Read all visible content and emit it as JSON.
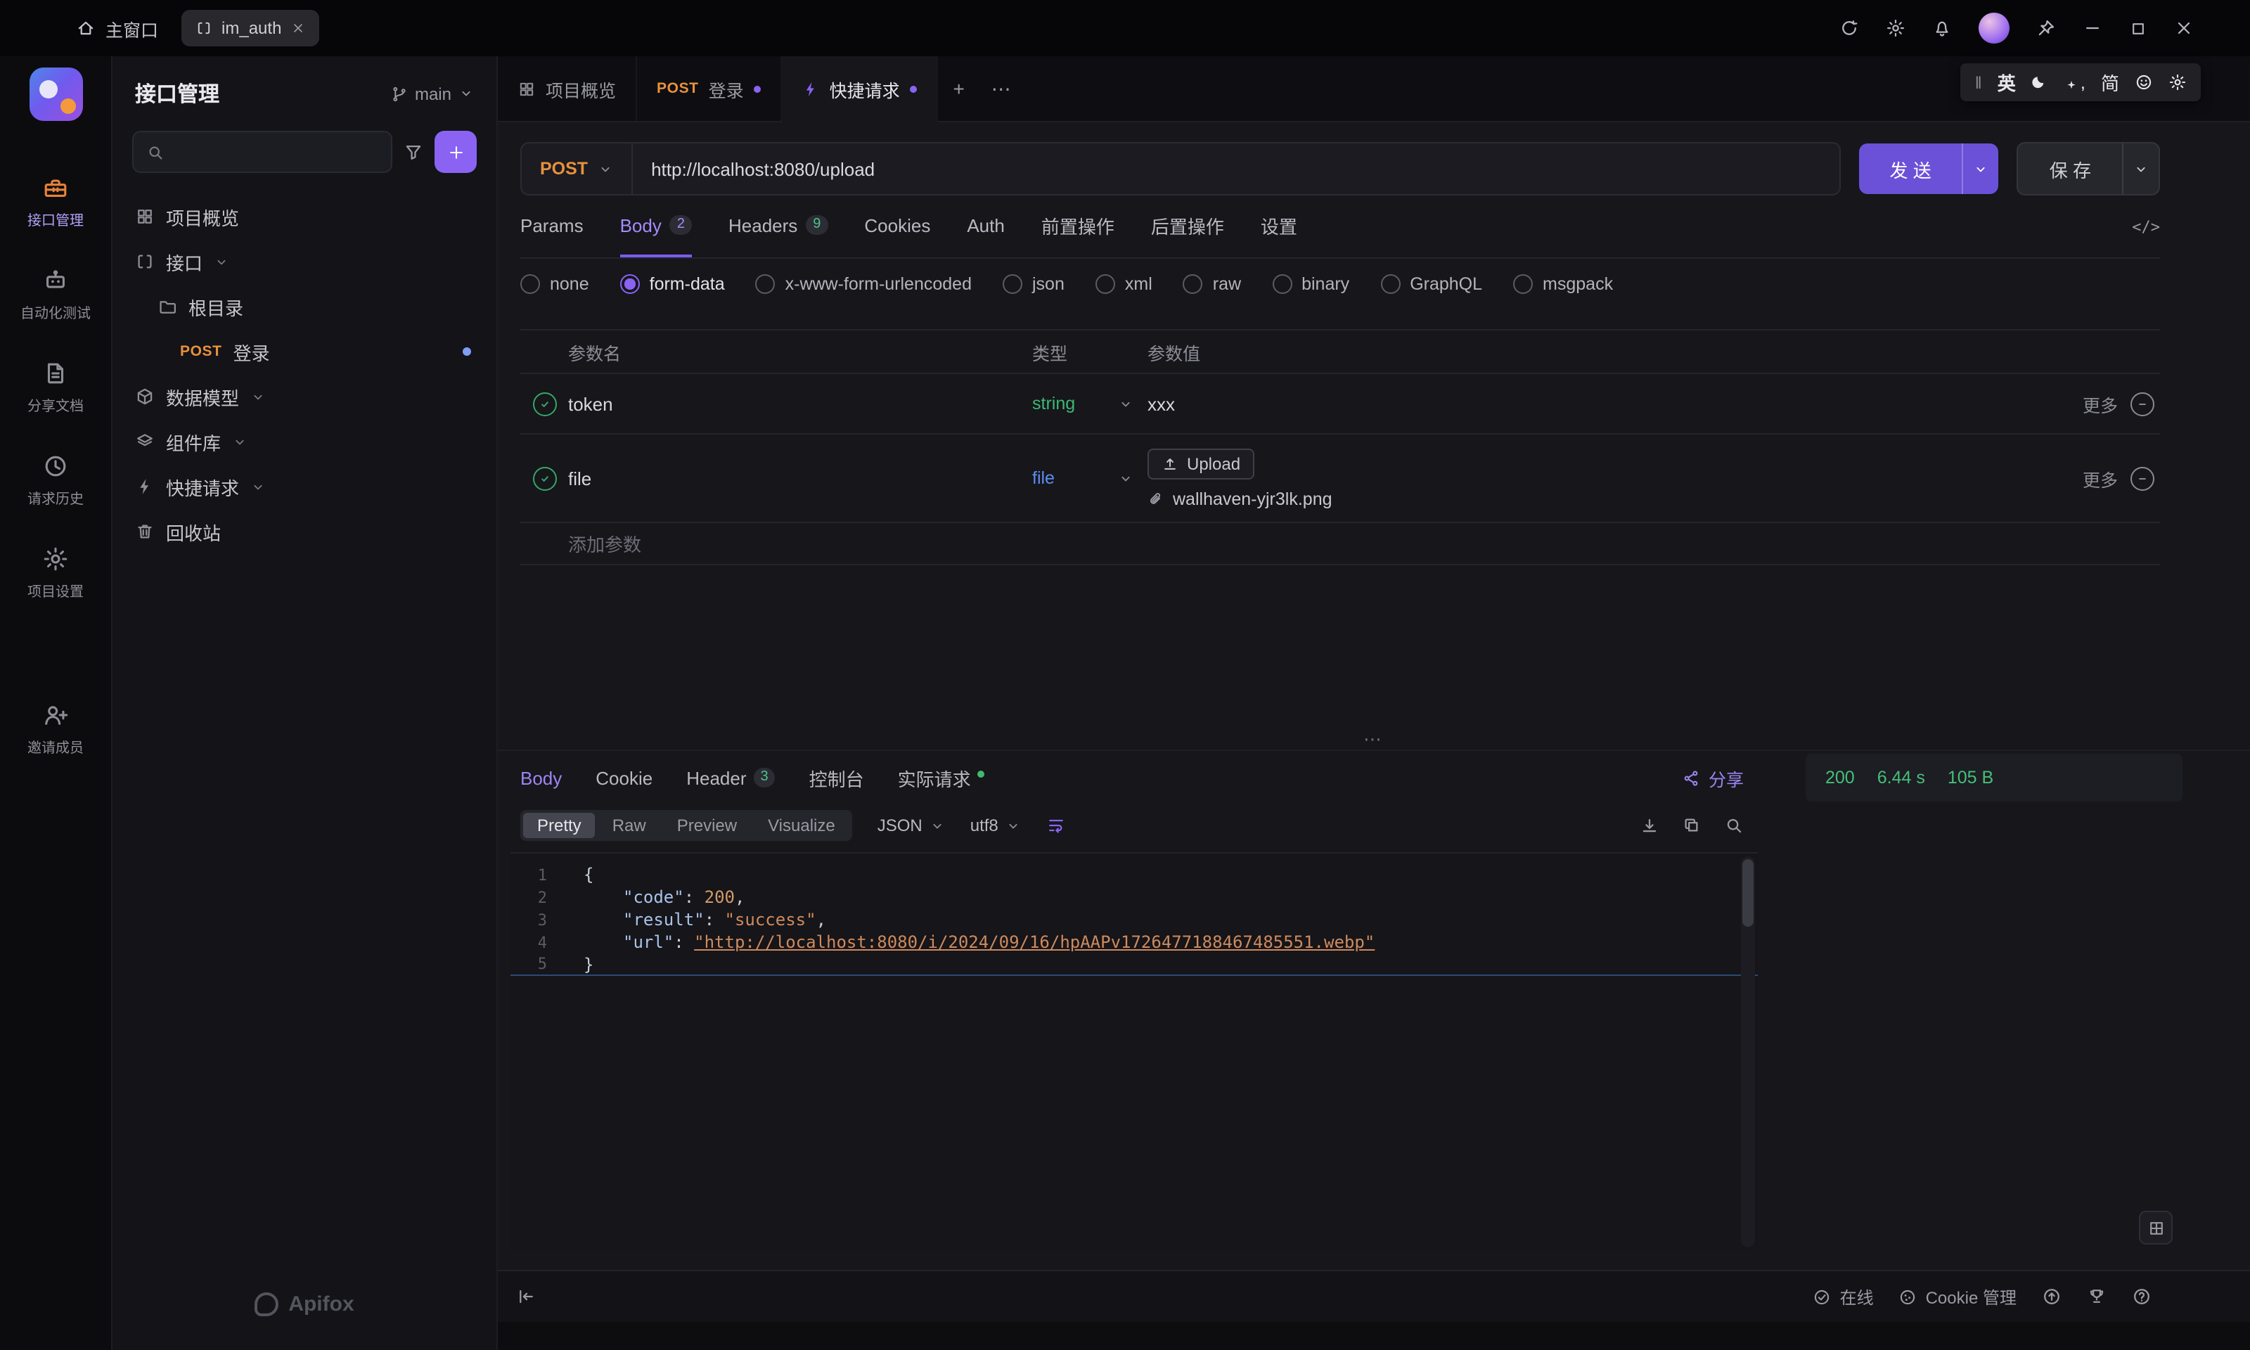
{
  "titlebar": {
    "home_label": "主窗口",
    "tab_label": "im_auth"
  },
  "ime": {
    "lang": "英",
    "punct": ",",
    "charset": "简"
  },
  "glyphs": {
    "more_h": "⋯",
    "handle": "‖",
    "code_view": "</>",
    "plus": "+"
  },
  "rail": {
    "items": [
      {
        "label": "接口管理"
      },
      {
        "label": "自动化测试"
      },
      {
        "label": "分享文档"
      },
      {
        "label": "请求历史"
      },
      {
        "label": "项目设置"
      },
      {
        "label": "邀请成员"
      }
    ]
  },
  "sidebar": {
    "title": "接口管理",
    "branch": "main",
    "items": {
      "overview": "项目概览",
      "api_group": "接口",
      "root_folder": "根目录",
      "login_method": "POST",
      "login_label": "登录",
      "data_models": "数据模型",
      "components": "组件库",
      "quick_request": "快捷请求",
      "recycle_bin": "回收站"
    },
    "brand": "Apifox"
  },
  "doc_tabs": {
    "overview": "项目概览",
    "login_method": "POST",
    "login_label": "登录",
    "quick_request": "快捷请求"
  },
  "request": {
    "method": "POST",
    "url": "http://localhost:8080/upload",
    "send": "发 送",
    "save": "保 存",
    "tabs": {
      "params": "Params",
      "body": "Body",
      "body_badge": "2",
      "headers": "Headers",
      "headers_badge": "9",
      "cookies": "Cookies",
      "auth": "Auth",
      "pre_ops": "前置操作",
      "post_ops": "后置操作",
      "settings": "设置"
    },
    "body_types": [
      "none",
      "form-data",
      "x-www-form-urlencoded",
      "json",
      "xml",
      "raw",
      "binary",
      "GraphQL",
      "msgpack"
    ],
    "table": {
      "col_name": "参数名",
      "col_type": "类型",
      "col_value": "参数值",
      "rows": [
        {
          "name": "token",
          "type": "string",
          "value": "xxx",
          "more": "更多"
        },
        {
          "name": "file",
          "type": "file",
          "upload": "Upload",
          "filename": "wallhaven-yjr3lk.png",
          "more": "更多"
        }
      ],
      "add_label": "添加参数"
    }
  },
  "response": {
    "tabs": {
      "body": "Body",
      "cookie": "Cookie",
      "header": "Header",
      "header_badge": "3",
      "console": "控制台",
      "actual": "实际请求"
    },
    "share": "分享",
    "status": {
      "code": "200",
      "time": "6.44 s",
      "size": "105 B"
    },
    "modes": [
      "Pretty",
      "Raw",
      "Preview",
      "Visualize"
    ],
    "format": "JSON",
    "encoding": "utf8",
    "code": {
      "nums": [
        "1",
        "2",
        "3",
        "4",
        "5"
      ],
      "l1": "{",
      "k2": "\"code\"",
      "v2": "200",
      "k3": "\"result\"",
      "v3": "\"success\"",
      "k4": "\"url\"",
      "v4": "\"http://localhost:8080/i/2024/09/16/hpAAPv1726477188467485551.webp\"",
      "l5": "}",
      "colon": ": ",
      "comma": ","
    }
  },
  "statusbar": {
    "online": "在线",
    "cookie_manager": "Cookie 管理"
  }
}
